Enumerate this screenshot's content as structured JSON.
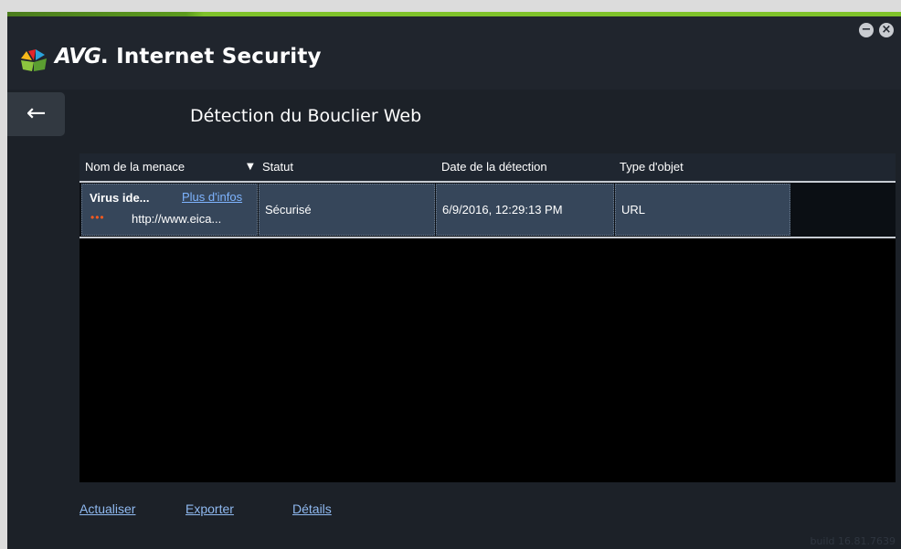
{
  "app": {
    "brand": "AVG",
    "product": "Internet Security",
    "logo_icon": "avg-logo-icon",
    "minimize_label": "−",
    "close_label": "×"
  },
  "page": {
    "title": "Détection du Bouclier Web",
    "back_label": "←"
  },
  "table": {
    "columns": [
      "Nom de la menace",
      "Statut",
      "Date de la détection",
      "Type d'objet"
    ],
    "sort_icon": "▼",
    "rows": [
      {
        "threat": "Virus ide...",
        "more_info": "Plus d'infos",
        "severity_dots": "•••",
        "url": "http://www.eica...",
        "status": "Sécurisé",
        "date": "6/9/2016, 12:29:13 PM",
        "type": "URL"
      }
    ]
  },
  "footer": {
    "refresh": "Actualiser",
    "export": "Exporter",
    "details": "Détails",
    "build": "build 16.81.7639"
  },
  "colors": {
    "accent_green": "#7fc22a",
    "link": "#8fb9f0",
    "row_bg": "#36465a",
    "severity": "#ff5a1e"
  }
}
